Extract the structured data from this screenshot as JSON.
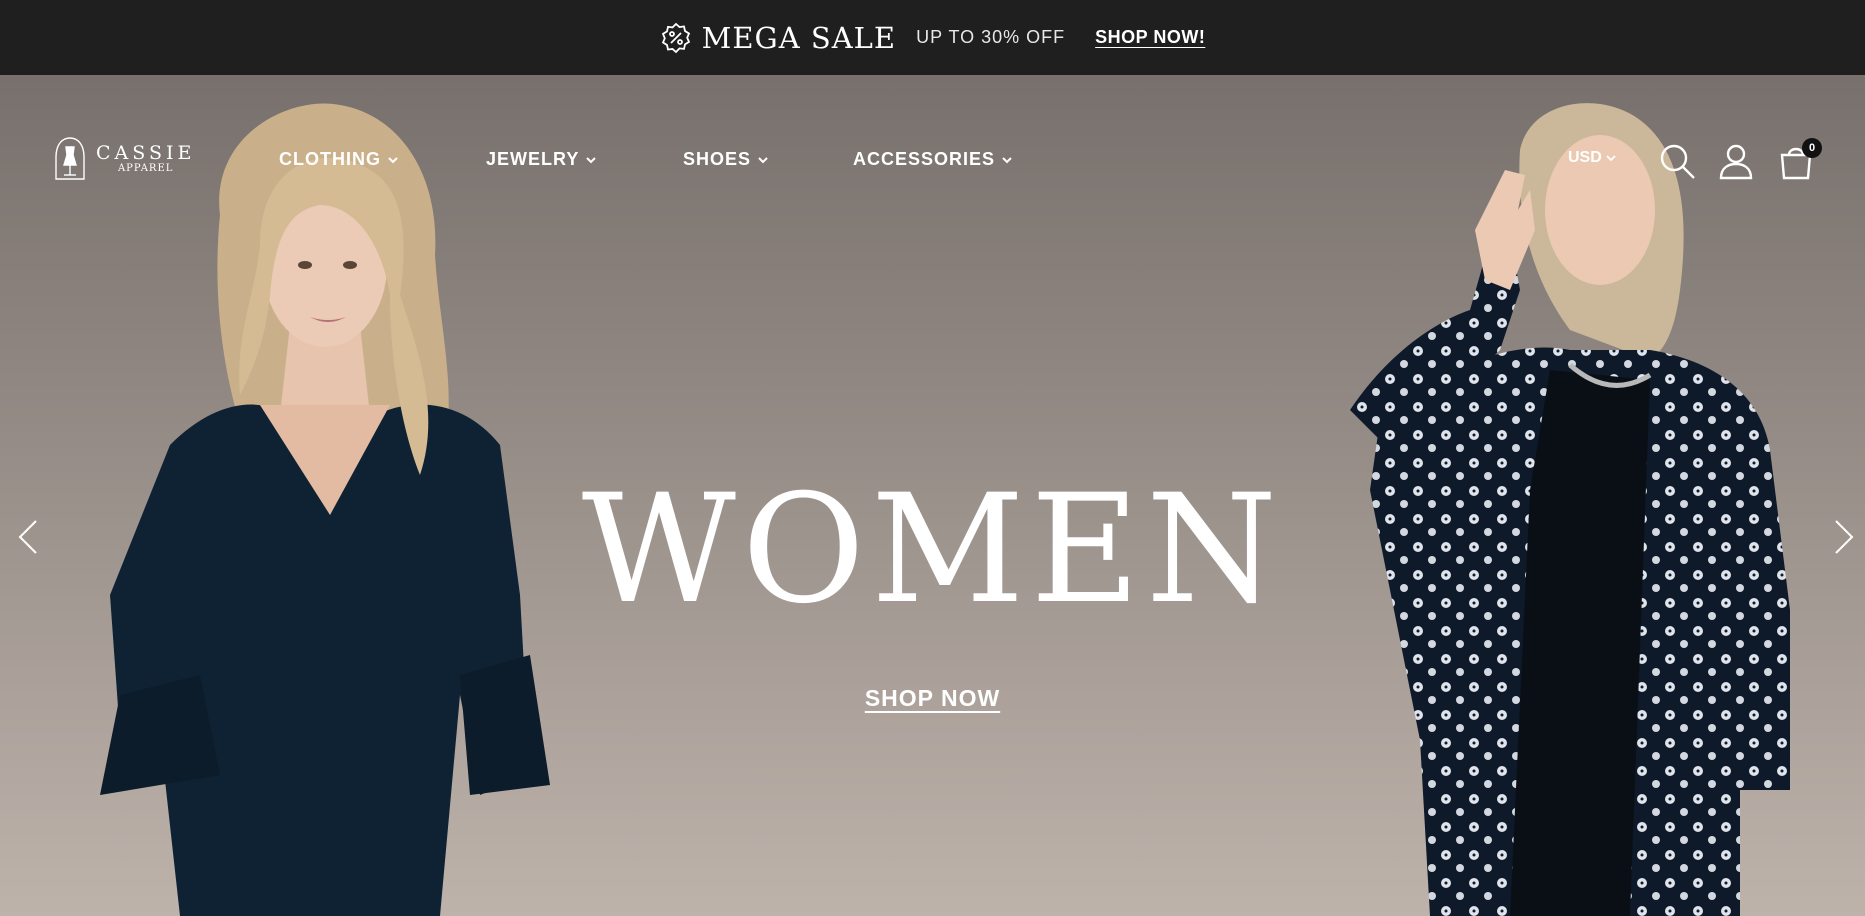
{
  "announcement": {
    "icon": "percent-badge-icon",
    "title": "MEGA SALE",
    "subtitle": "UP TO 30% OFF",
    "cta": "SHOP NOW!"
  },
  "header": {
    "logo": {
      "brand": "CASSIE",
      "sub": "APPAREL",
      "icon": "dress-form-icon"
    },
    "nav": [
      {
        "label": "CLOTHING"
      },
      {
        "label": "JEWELRY"
      },
      {
        "label": "SHOES"
      },
      {
        "label": "ACCESSORIES"
      }
    ],
    "currency": "USD",
    "icons": [
      "search-icon",
      "user-icon",
      "cart-icon"
    ],
    "cart_count": "0"
  },
  "hero": {
    "title": "WOMEN",
    "cta": "SHOP NOW",
    "prev_icon": "chevron-left-icon",
    "next_icon": "chevron-right-icon"
  },
  "colors": {
    "bar": "#1f1f1f",
    "hero_top": "#77706c",
    "hero_bottom": "#bdb3ab",
    "text": "#ffffff"
  }
}
